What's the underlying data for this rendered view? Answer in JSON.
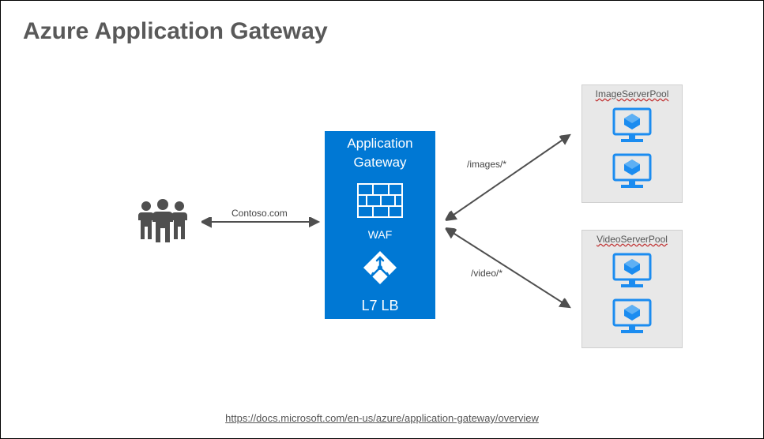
{
  "title": "Azure Application Gateway",
  "users_label": "",
  "gateway": {
    "title_line1": "Application",
    "title_line2": "Gateway",
    "waf_label": "WAF",
    "lb_label": "L7 LB"
  },
  "connections": {
    "client_label": "Contoso.com",
    "route1_label": "/images/*",
    "route2_label": "/video/*"
  },
  "pools": {
    "pool1_title": "ImageServerPool",
    "pool2_title": "VideoServerPool"
  },
  "footer_url": "https://docs.microsoft.com/en-us/azure/application-gateway/overview"
}
